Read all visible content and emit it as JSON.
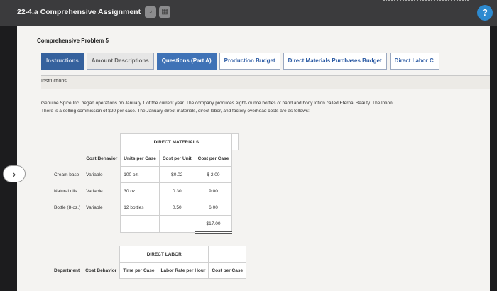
{
  "window": {
    "title": "22-4.a Comprehensive Assignment"
  },
  "problem": {
    "title": "Comprehensive Problem 5"
  },
  "tabs": [
    {
      "label": "Instructions"
    },
    {
      "label": "Amount Descriptions"
    },
    {
      "label": "Questions (Part A)"
    },
    {
      "label": "Production Budget"
    },
    {
      "label": "Direct Materials Purchases Budget"
    },
    {
      "label": "Direct Labor C"
    }
  ],
  "section": {
    "label": "Instructions"
  },
  "description": {
    "line1": "Genuine Spice Inc. began operations on January 1 of the current year. The company produces eight- ounce bottles of hand and body lotion called Eternal Beauty. The lotion",
    "line2": "There is a selling commission of $20 per case. The January direct materials, direct labor, and factory overhead costs are as follows:"
  },
  "direct_materials": {
    "title": "DIRECT MATERIALS",
    "headers": [
      "Cost Behavior",
      "Units per Case",
      "Cost per Unit",
      "Cost per Case"
    ],
    "rows": [
      {
        "item": "Cream base",
        "behavior": "Variable",
        "units": "100 oz.",
        "cost_unit": "$0.02",
        "cost_case": "$ 2.00"
      },
      {
        "item": "Natural oils",
        "behavior": "Variable",
        "units": "30 oz.",
        "cost_unit": "0.30",
        "cost_case": "9.00"
      },
      {
        "item": "Bottle (8-oz.)",
        "behavior": "Variable",
        "units": "12 bottles",
        "cost_unit": "0.50",
        "cost_case": "6.00"
      }
    ],
    "total": "$17.00"
  },
  "direct_labor": {
    "title": "DIRECT LABOR",
    "headers": [
      "Department",
      "Cost Behavior",
      "Time per Case",
      "Labor Rate per Hour",
      "Cost per Case"
    ]
  }
}
